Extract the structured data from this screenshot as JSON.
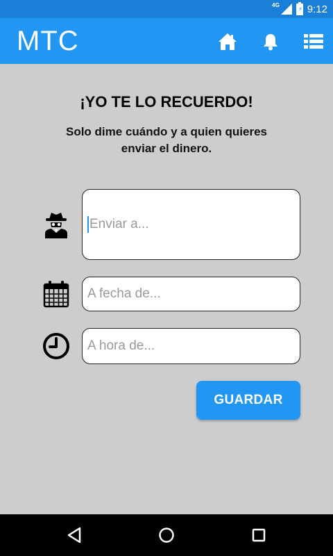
{
  "status_bar": {
    "network": "4G",
    "battery_glyph": "⚡",
    "time": "9:12"
  },
  "app_bar": {
    "title": "MTC",
    "icons": [
      "home-icon",
      "bell-icon",
      "list-icon"
    ]
  },
  "content": {
    "heading": "¡YO TE LO RECUERDO!",
    "subheading": "Solo dime cuándo y a quien quieres enviar el dinero."
  },
  "form": {
    "recipient": {
      "value": "",
      "placeholder": "Enviar a...",
      "icon": "spy-icon"
    },
    "date": {
      "value": "",
      "placeholder": "A fecha de...",
      "icon": "calendar-icon"
    },
    "time": {
      "value": "",
      "placeholder": "A hora de...",
      "icon": "clock-icon"
    },
    "save_label": "GUARDAR"
  },
  "colors": {
    "status_bar": "#1a7fd6",
    "app_bar": "#2196f3",
    "background": "#cdcdcd",
    "button": "#2196f3"
  },
  "nav_bar": {
    "icons": [
      "back-icon",
      "home-circle-icon",
      "recents-icon"
    ]
  }
}
